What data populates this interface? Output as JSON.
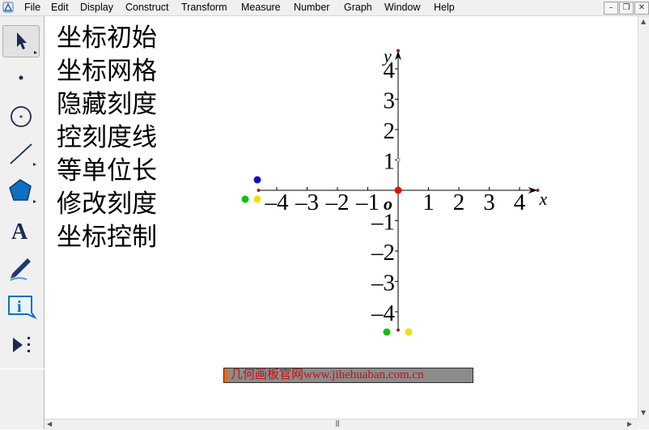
{
  "menu": {
    "items": [
      "File",
      "Edit",
      "Display",
      "Construct",
      "Transform",
      "Measure",
      "Number",
      "Graph",
      "Window",
      "Help"
    ]
  },
  "window_buttons": {
    "minimize": "–",
    "restore": "❐",
    "close": "✕"
  },
  "toolbox": {
    "tools": [
      {
        "name": "arrow-tool-icon",
        "selected": true
      },
      {
        "name": "point-tool-icon",
        "selected": false
      },
      {
        "name": "compass-tool-icon",
        "selected": false
      },
      {
        "name": "straightedge-tool-icon",
        "selected": false
      },
      {
        "name": "polygon-tool-icon",
        "selected": false
      },
      {
        "name": "text-tool-icon",
        "selected": false
      },
      {
        "name": "marker-tool-icon",
        "selected": false
      },
      {
        "name": "information-tool-icon",
        "selected": false
      },
      {
        "name": "custom-tool-icon",
        "selected": false
      }
    ],
    "text_tool_glyph": "A"
  },
  "commands": [
    "坐标初始",
    "坐标网格",
    "隐藏刻度",
    "控刻度线",
    "等单位长",
    "修改刻度",
    "坐标控制"
  ],
  "axes": {
    "x_name": "x",
    "y_name": "y",
    "origin_label": "o",
    "x_ticks": [
      {
        "value": -4,
        "label": "–4"
      },
      {
        "value": -3,
        "label": "–3"
      },
      {
        "value": -2,
        "label": "–2"
      },
      {
        "value": -1,
        "label": "–1"
      },
      {
        "value": 1,
        "label": "1"
      },
      {
        "value": 2,
        "label": "2"
      },
      {
        "value": 3,
        "label": "3"
      },
      {
        "value": 4,
        "label": "4"
      }
    ],
    "y_ticks": [
      {
        "value": 4,
        "label": "4"
      },
      {
        "value": 3,
        "label": "3"
      },
      {
        "value": 2,
        "label": "2"
      },
      {
        "value": 1,
        "label": "1"
      },
      {
        "value": -1,
        "label": "–1"
      },
      {
        "value": -2,
        "label": "–2"
      },
      {
        "value": -3,
        "label": "–3"
      },
      {
        "value": -4,
        "label": "–4"
      }
    ]
  },
  "colors": {
    "origin_point": "#e01010",
    "control_blue": "#1010c0",
    "control_green": "#10c010",
    "control_yellow": "#f0e010",
    "caption_text": "#c81010",
    "caption_bar": "#ea6a10",
    "caption_bg": "#8c8c8c"
  },
  "caption": {
    "text": "几何画板官网www.jihehuaban.com.cn"
  }
}
